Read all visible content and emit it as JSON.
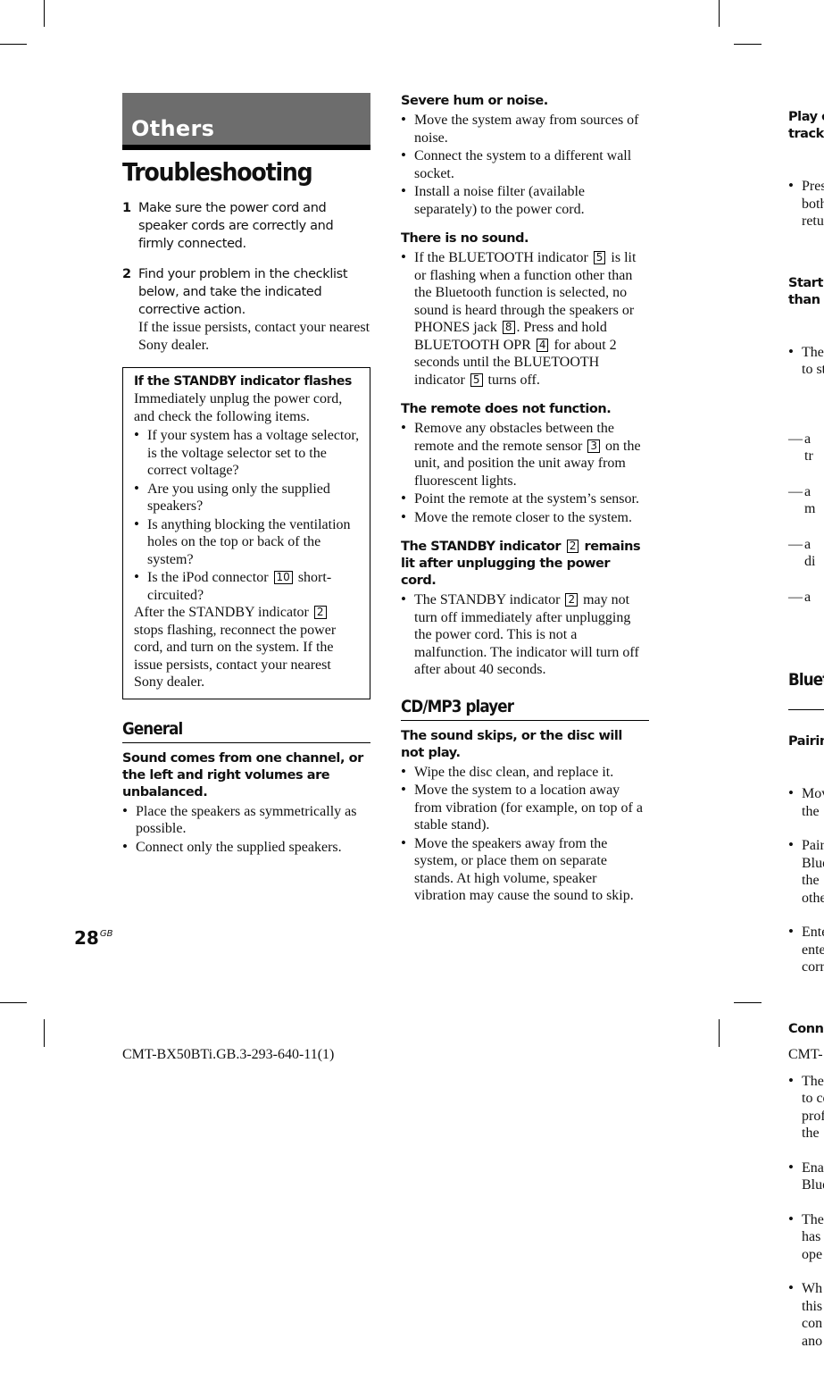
{
  "chapter_tab": "Others",
  "page_title": "Troubleshooting",
  "steps": [
    {
      "num": "1",
      "text": "Make sure the power cord and speaker cords are correctly and firmly connected.",
      "note": ""
    },
    {
      "num": "2",
      "text": "Find your problem in the checklist below, and take the indicated corrective action.",
      "note": "If the issue persists, contact your nearest Sony dealer."
    }
  ],
  "standby_box": {
    "title": "If the STANDBY indicator flashes",
    "intro": "Immediately unplug the power cord, and check the following items.",
    "items": [
      "If your system has a voltage selector, is the voltage selector set to the correct voltage?",
      "Are you using only the supplied speakers?",
      "Is anything blocking the ventilation holes on the top or back of the system?"
    ],
    "item4_pre": "Is the iPod connector",
    "item4_ref": "10",
    "item4_post": "short-circuited?",
    "after_pre": "After the STANDBY indicator",
    "after_ref": "2",
    "after_post": "stops flashing, reconnect the power cord, and turn on the system. If the issue persists, contact your nearest Sony dealer."
  },
  "general": {
    "heading": "General",
    "q1": "Sound comes from one channel, or the left and right volumes are unbalanced.",
    "q1_items": [
      "Place the speakers as symmetrically as possible.",
      "Connect only the supplied speakers."
    ]
  },
  "col2": {
    "q_hum": "Severe hum or noise.",
    "hum_items": [
      "Move the system away from sources of noise.",
      "Connect the system to a different wall socket.",
      "Install a noise filter (available separately) to the power cord."
    ],
    "q_nosound": "There is no sound.",
    "nosound": {
      "t1": "If the BLUETOOTH indicator",
      "r1": "5",
      "t2": "is lit or flashing when a function other than the Bluetooth function is selected, no sound is heard through the speakers or PHONES jack",
      "r2": "8",
      "t3": ". Press and hold BLUETOOTH OPR",
      "r3": "4",
      "t4": "for about 2 seconds until the BLUETOOTH indicator",
      "r4": "5",
      "t5": "turns off."
    },
    "q_remote": "The remote does not function.",
    "remote": {
      "i1_pre": "Remove any obstacles between the remote and the remote sensor",
      "i1_ref": "3",
      "i1_post": "on the unit, and position the unit away from fluorescent lights.",
      "i2": "Point the remote at the system’s sensor.",
      "i3": "Move the remote closer to the system."
    },
    "q_standby_pre": "The STANDBY indicator",
    "q_standby_ref": "2",
    "q_standby_post": "remains lit after unplugging the power cord.",
    "standby_item_pre": "The STANDBY indicator",
    "standby_item_ref": "2",
    "standby_item_post": "may not turn off immediately after unplugging the power cord. This is not a malfunction. The indicator will turn off after about 40 seconds.",
    "cd_heading": "CD/MP3 player",
    "q_skip": "The sound skips, or the disc will not play.",
    "skip_items": [
      "Wipe the disc clean, and replace it.",
      "Move the system to a location away from vibration (for example, on top of a stable stand).",
      "Move the speakers away from the system, or place them on separate stands. At high volume, speaker vibration may cause the sound to skip."
    ]
  },
  "col3_partial": {
    "q_play": "Play c\ntrack.",
    "play_item": "Pres\nboth\nretu",
    "q_start": "Starti\nthan t",
    "start_item": "The\nto st",
    "start_dashes": [
      "a\ntr",
      "a\nm",
      "a\ndi",
      "a"
    ],
    "bt_heading": "Bluet",
    "q_pairing": "Pairin",
    "pairing_items": [
      "Mov\nthe",
      "Pair\nBlue\nthe\nothe",
      "Ente\nente\ncorr"
    ],
    "q_conn": "Conn",
    "conn_items": [
      "The\nto co\nprof\nthe",
      "Ena\nBlue",
      "The\nhas\nope",
      "Wh\nthis\ncon\nano"
    ]
  },
  "footer": {
    "page_number": "28",
    "page_suffix": "GB",
    "doc_code": "CMT-BX50BTi.GB.3-293-640-11(1)",
    "doc_code_next": "CMT-"
  }
}
